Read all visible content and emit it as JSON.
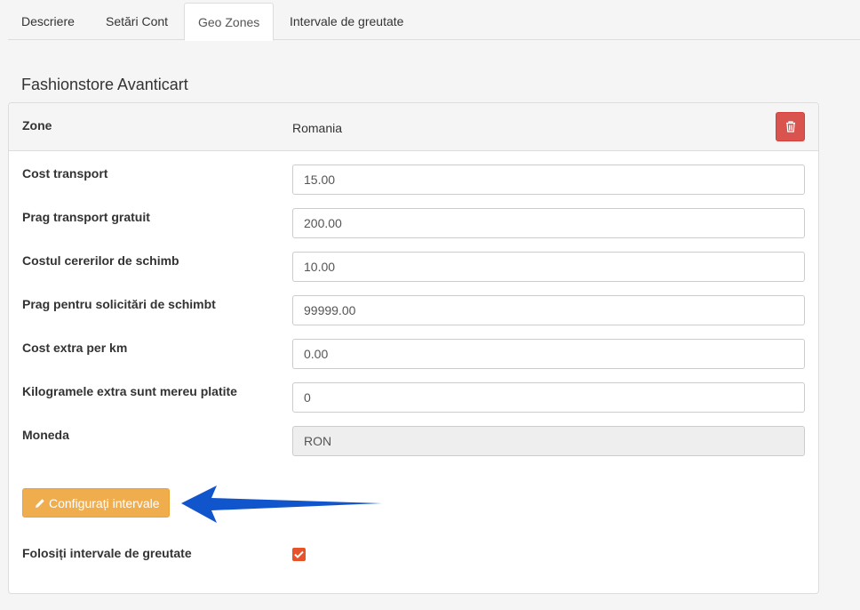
{
  "tabs": [
    {
      "label": "Descriere"
    },
    {
      "label": "Setări Cont"
    },
    {
      "label": "Geo Zones"
    },
    {
      "label": "Intervale de greutate"
    }
  ],
  "active_tab": "Geo Zones",
  "store_title": "Fashionstore Avanticart",
  "zone": {
    "label": "Zone",
    "value": "Romania"
  },
  "fields": [
    {
      "label": "Cost transport",
      "value": "15.00"
    },
    {
      "label": "Prag transport gratuit",
      "value": "200.00"
    },
    {
      "label": "Costul cererilor de schimb",
      "value": "10.00"
    },
    {
      "label": "Prag pentru solicitări de schimbt",
      "value": "99999.00"
    },
    {
      "label": "Cost extra per km",
      "value": "0.00"
    },
    {
      "label": "Kilogramele extra sunt mereu platite",
      "value": "0"
    },
    {
      "label": "Moneda",
      "value": "RON"
    }
  ],
  "config_button_label": "Configurați intervale",
  "weight_intervals": {
    "label": "Folosiți intervale de greutate",
    "checked": true
  },
  "colors": {
    "delete": "#d9534f",
    "config_button": "#f0ad4e",
    "arrow": "#1155cc",
    "checkbox": "#e8522b"
  },
  "icons": {
    "delete": "trash-icon",
    "config": "pencil-icon",
    "annotation": "arrow-left-icon",
    "checkbox": "checkmark-icon"
  }
}
